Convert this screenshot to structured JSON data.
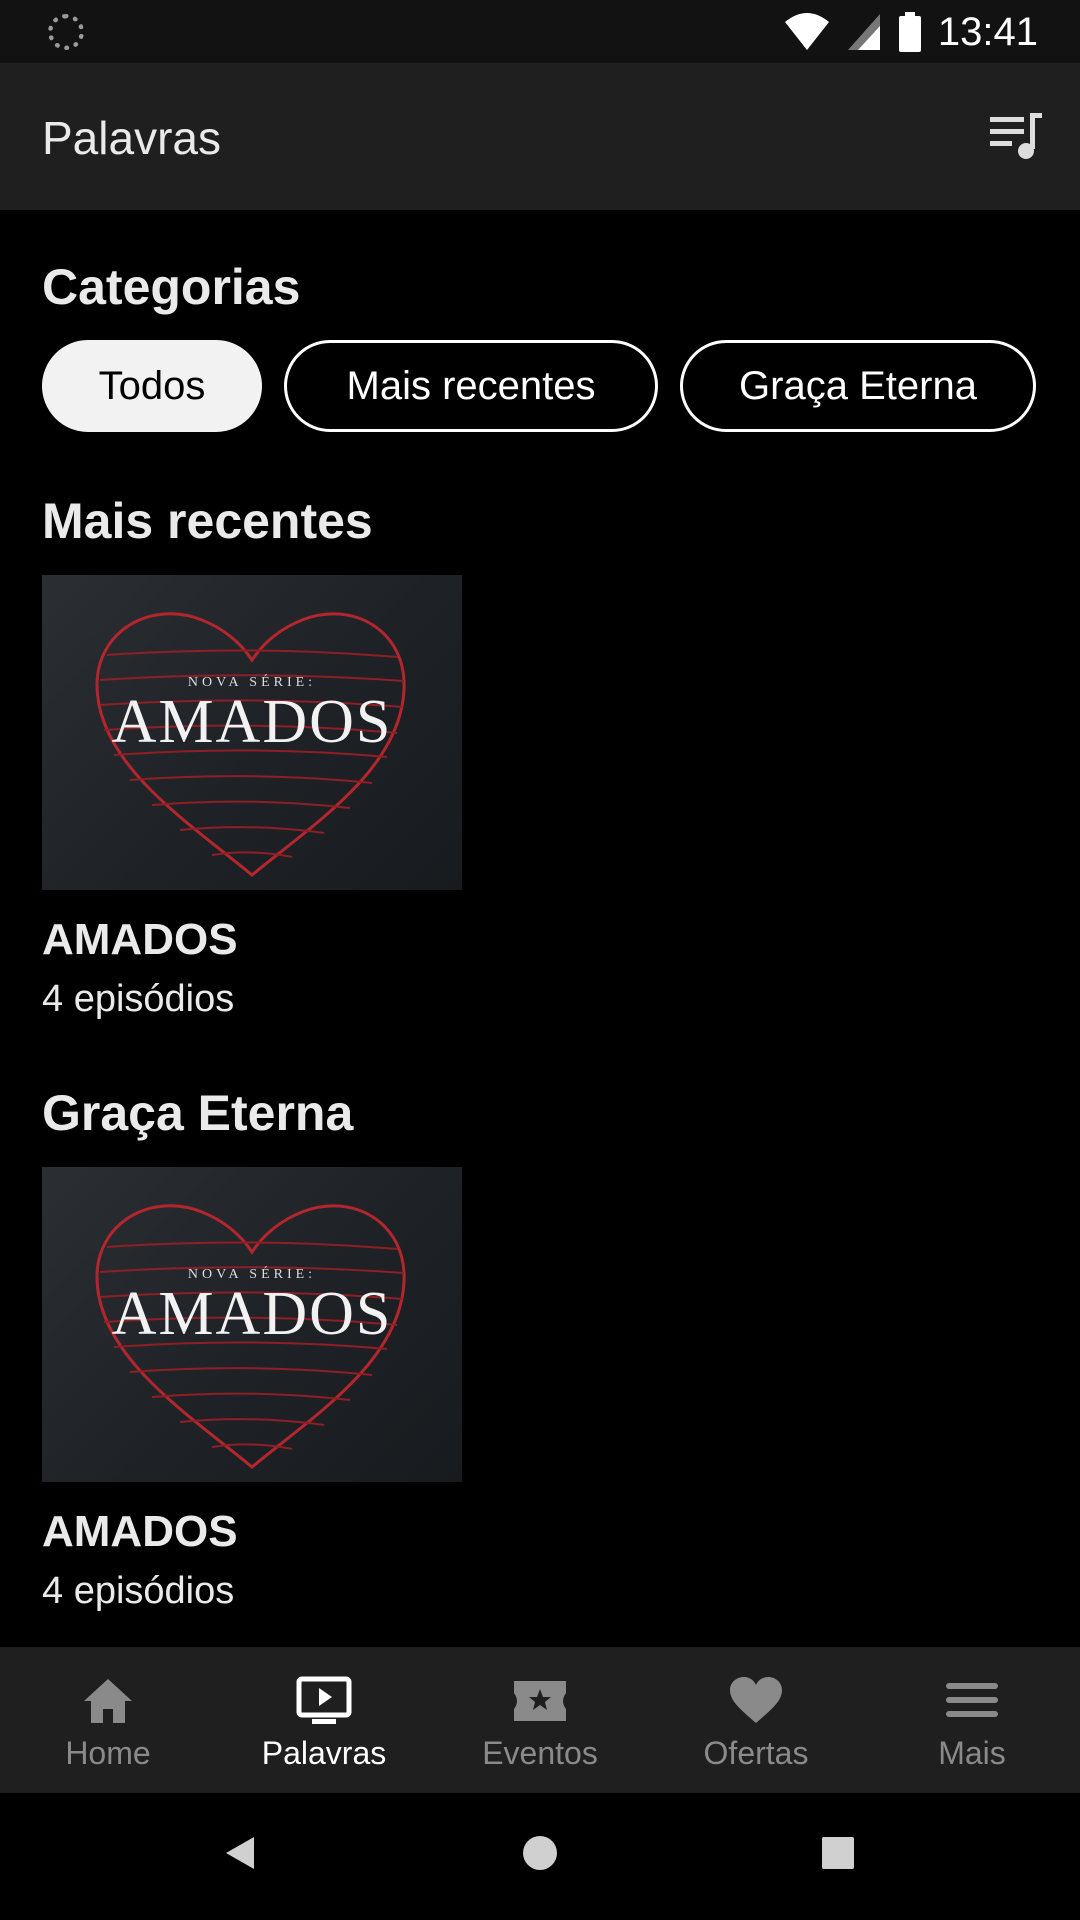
{
  "status_bar": {
    "time": "13:41"
  },
  "app_bar": {
    "title": "Palavras",
    "queue_icon": "queue-music-icon"
  },
  "categories": {
    "heading": "Categorias",
    "chips": [
      {
        "label": "Todos",
        "active": true
      },
      {
        "label": "Mais recentes",
        "active": false
      },
      {
        "label": "Graça Eterna",
        "active": false
      }
    ]
  },
  "sections": [
    {
      "title": "Mais recentes",
      "item": {
        "art_subtitle": "NOVA SÉRIE:",
        "art_title": "AMADOS",
        "title": "AMADOS",
        "subtitle": "4 episódios"
      }
    },
    {
      "title": "Graça Eterna",
      "item": {
        "art_subtitle": "NOVA SÉRIE:",
        "art_title": "AMADOS",
        "title": "AMADOS",
        "subtitle": "4 episódios"
      }
    }
  ],
  "bottom_nav": [
    {
      "label": "Home",
      "icon": "home-icon",
      "active": false
    },
    {
      "label": "Palavras",
      "icon": "tv-play-icon",
      "active": true
    },
    {
      "label": "Eventos",
      "icon": "ticket-star-icon",
      "active": false
    },
    {
      "label": "Ofertas",
      "icon": "heart-icon",
      "active": false
    },
    {
      "label": "Mais",
      "icon": "menu-icon",
      "active": false
    }
  ],
  "colors": {
    "background": "#000000",
    "bar": "#1f1f1f",
    "accent_heart": "#b3262d"
  }
}
